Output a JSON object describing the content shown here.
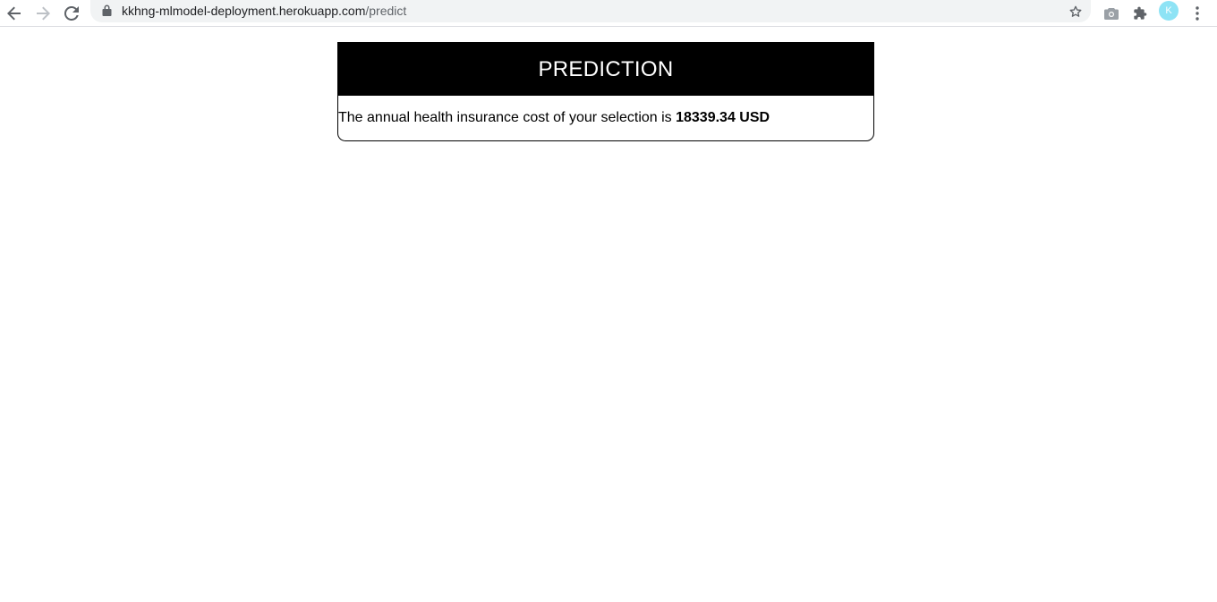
{
  "browser": {
    "url_host": "kkhng-mlmodel-deployment.herokuapp.com",
    "url_path": "/predict",
    "profile_initial": "K",
    "icons": {
      "back": "arrow-left-icon",
      "forward": "arrow-right-icon",
      "reload": "reload-icon",
      "lock": "lock-icon",
      "bookmark": "star-icon",
      "screenshot": "camera-icon",
      "extensions": "puzzle-icon",
      "menu": "kebab-menu-icon"
    },
    "colors": {
      "omnibox": "#f1f3f4",
      "avatar": "#8ee3f5"
    }
  },
  "prediction": {
    "title": "PREDICTION",
    "text": "The annual health insurance cost of your selection is ",
    "value": "18339.34 USD",
    "colors": {
      "header_bg": "#000000",
      "header_text": "#ffffff"
    }
  }
}
